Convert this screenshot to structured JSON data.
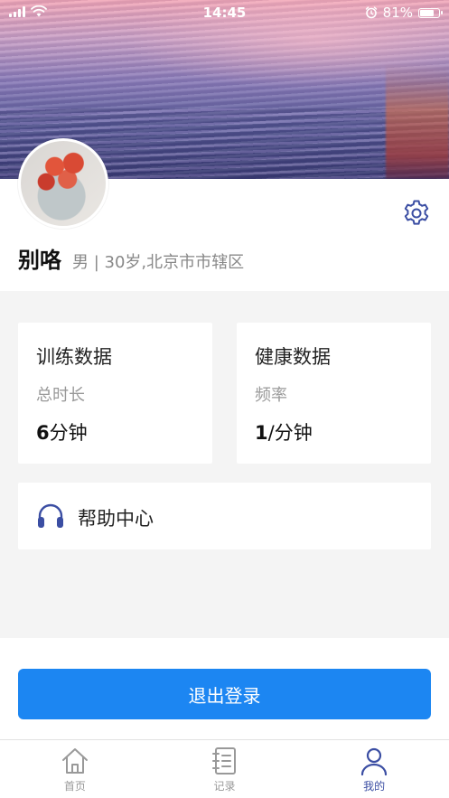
{
  "status_bar": {
    "time": "14:45",
    "battery_percent": "81%",
    "battery_level": 0.81
  },
  "profile": {
    "name": "别咯",
    "info": "男 | 30岁,北京市市辖区"
  },
  "cards": {
    "training": {
      "title": "训练数据",
      "label": "总时长",
      "value_number": "6",
      "value_unit": "分钟"
    },
    "health": {
      "title": "健康数据",
      "label": "频率",
      "value_number": "1",
      "value_unit": "/分钟"
    }
  },
  "help": {
    "label": "帮助中心"
  },
  "logout": {
    "label": "退出登录"
  },
  "tabbar": {
    "items": [
      {
        "label": "首页",
        "icon": "home-icon",
        "active": false
      },
      {
        "label": "记录",
        "icon": "record-icon",
        "active": false
      },
      {
        "label": "我的",
        "icon": "profile-icon",
        "active": true
      }
    ]
  },
  "colors": {
    "primary": "#1c86f2",
    "icon_accent": "#3b4ea3",
    "inactive": "#999999"
  }
}
